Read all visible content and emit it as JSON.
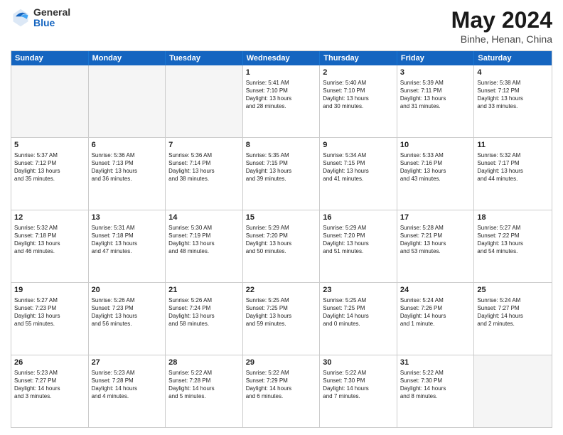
{
  "logo": {
    "general": "General",
    "blue": "Blue"
  },
  "title": {
    "month": "May 2024",
    "location": "Binhe, Henan, China"
  },
  "header_days": [
    "Sunday",
    "Monday",
    "Tuesday",
    "Wednesday",
    "Thursday",
    "Friday",
    "Saturday"
  ],
  "weeks": [
    [
      {
        "day": "",
        "text": "",
        "empty": true
      },
      {
        "day": "",
        "text": "",
        "empty": true
      },
      {
        "day": "",
        "text": "",
        "empty": true
      },
      {
        "day": "1",
        "text": "Sunrise: 5:41 AM\nSunset: 7:10 PM\nDaylight: 13 hours\nand 28 minutes."
      },
      {
        "day": "2",
        "text": "Sunrise: 5:40 AM\nSunset: 7:10 PM\nDaylight: 13 hours\nand 30 minutes."
      },
      {
        "day": "3",
        "text": "Sunrise: 5:39 AM\nSunset: 7:11 PM\nDaylight: 13 hours\nand 31 minutes."
      },
      {
        "day": "4",
        "text": "Sunrise: 5:38 AM\nSunset: 7:12 PM\nDaylight: 13 hours\nand 33 minutes."
      }
    ],
    [
      {
        "day": "5",
        "text": "Sunrise: 5:37 AM\nSunset: 7:12 PM\nDaylight: 13 hours\nand 35 minutes."
      },
      {
        "day": "6",
        "text": "Sunrise: 5:36 AM\nSunset: 7:13 PM\nDaylight: 13 hours\nand 36 minutes."
      },
      {
        "day": "7",
        "text": "Sunrise: 5:36 AM\nSunset: 7:14 PM\nDaylight: 13 hours\nand 38 minutes."
      },
      {
        "day": "8",
        "text": "Sunrise: 5:35 AM\nSunset: 7:15 PM\nDaylight: 13 hours\nand 39 minutes."
      },
      {
        "day": "9",
        "text": "Sunrise: 5:34 AM\nSunset: 7:15 PM\nDaylight: 13 hours\nand 41 minutes."
      },
      {
        "day": "10",
        "text": "Sunrise: 5:33 AM\nSunset: 7:16 PM\nDaylight: 13 hours\nand 43 minutes."
      },
      {
        "day": "11",
        "text": "Sunrise: 5:32 AM\nSunset: 7:17 PM\nDaylight: 13 hours\nand 44 minutes."
      }
    ],
    [
      {
        "day": "12",
        "text": "Sunrise: 5:32 AM\nSunset: 7:18 PM\nDaylight: 13 hours\nand 46 minutes."
      },
      {
        "day": "13",
        "text": "Sunrise: 5:31 AM\nSunset: 7:18 PM\nDaylight: 13 hours\nand 47 minutes."
      },
      {
        "day": "14",
        "text": "Sunrise: 5:30 AM\nSunset: 7:19 PM\nDaylight: 13 hours\nand 48 minutes."
      },
      {
        "day": "15",
        "text": "Sunrise: 5:29 AM\nSunset: 7:20 PM\nDaylight: 13 hours\nand 50 minutes."
      },
      {
        "day": "16",
        "text": "Sunrise: 5:29 AM\nSunset: 7:20 PM\nDaylight: 13 hours\nand 51 minutes."
      },
      {
        "day": "17",
        "text": "Sunrise: 5:28 AM\nSunset: 7:21 PM\nDaylight: 13 hours\nand 53 minutes."
      },
      {
        "day": "18",
        "text": "Sunrise: 5:27 AM\nSunset: 7:22 PM\nDaylight: 13 hours\nand 54 minutes."
      }
    ],
    [
      {
        "day": "19",
        "text": "Sunrise: 5:27 AM\nSunset: 7:23 PM\nDaylight: 13 hours\nand 55 minutes."
      },
      {
        "day": "20",
        "text": "Sunrise: 5:26 AM\nSunset: 7:23 PM\nDaylight: 13 hours\nand 56 minutes."
      },
      {
        "day": "21",
        "text": "Sunrise: 5:26 AM\nSunset: 7:24 PM\nDaylight: 13 hours\nand 58 minutes."
      },
      {
        "day": "22",
        "text": "Sunrise: 5:25 AM\nSunset: 7:25 PM\nDaylight: 13 hours\nand 59 minutes."
      },
      {
        "day": "23",
        "text": "Sunrise: 5:25 AM\nSunset: 7:25 PM\nDaylight: 14 hours\nand 0 minutes."
      },
      {
        "day": "24",
        "text": "Sunrise: 5:24 AM\nSunset: 7:26 PM\nDaylight: 14 hours\nand 1 minute."
      },
      {
        "day": "25",
        "text": "Sunrise: 5:24 AM\nSunset: 7:27 PM\nDaylight: 14 hours\nand 2 minutes."
      }
    ],
    [
      {
        "day": "26",
        "text": "Sunrise: 5:23 AM\nSunset: 7:27 PM\nDaylight: 14 hours\nand 3 minutes."
      },
      {
        "day": "27",
        "text": "Sunrise: 5:23 AM\nSunset: 7:28 PM\nDaylight: 14 hours\nand 4 minutes."
      },
      {
        "day": "28",
        "text": "Sunrise: 5:22 AM\nSunset: 7:28 PM\nDaylight: 14 hours\nand 5 minutes."
      },
      {
        "day": "29",
        "text": "Sunrise: 5:22 AM\nSunset: 7:29 PM\nDaylight: 14 hours\nand 6 minutes."
      },
      {
        "day": "30",
        "text": "Sunrise: 5:22 AM\nSunset: 7:30 PM\nDaylight: 14 hours\nand 7 minutes."
      },
      {
        "day": "31",
        "text": "Sunrise: 5:22 AM\nSunset: 7:30 PM\nDaylight: 14 hours\nand 8 minutes."
      },
      {
        "day": "",
        "text": "",
        "empty": true
      }
    ]
  ]
}
